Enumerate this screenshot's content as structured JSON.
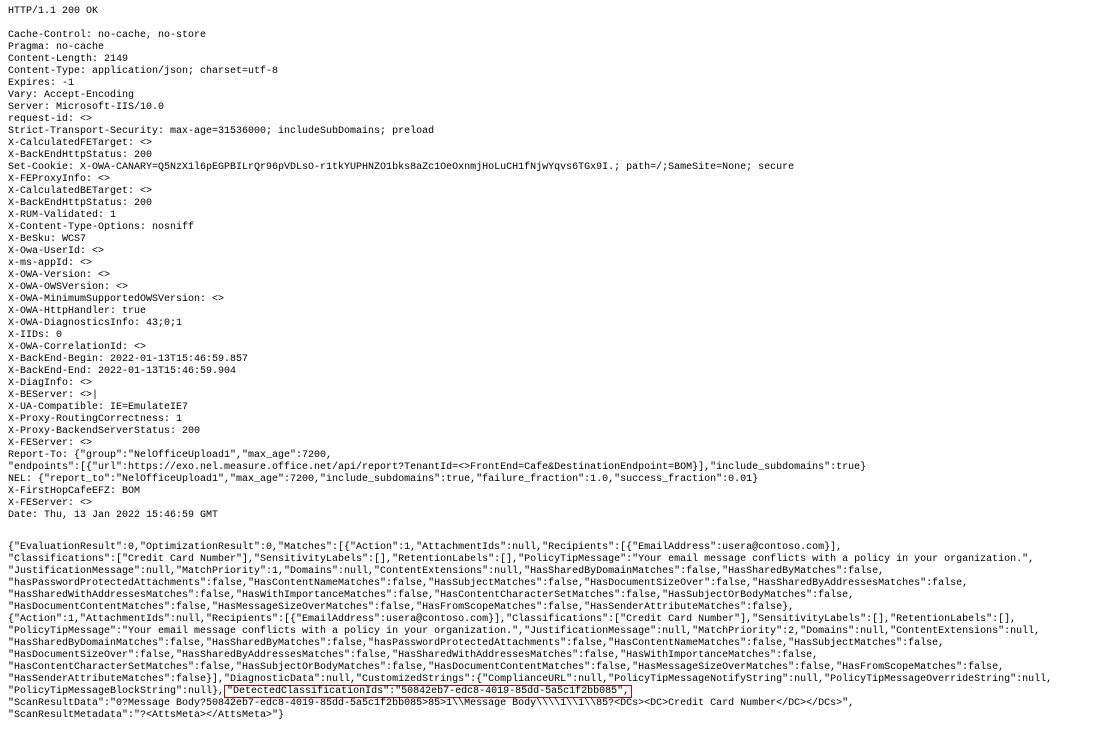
{
  "http": {
    "status_line": "HTTP/1.1 200 OK",
    "headers": [
      "Cache-Control: no-cache, no-store",
      "Pragma: no-cache",
      "Content-Length: 2149",
      "Content-Type: application/json; charset=utf-8",
      "Expires: -1",
      "Vary: Accept-Encoding",
      "Server: Microsoft-IIS/10.0",
      "request-id: <>",
      "Strict-Transport-Security: max-age=31536000; includeSubDomains; preload",
      "X-CalculatedFETarget: <>",
      "X-BackEndHttpStatus: 200",
      "Set-Cookie: X-OWA-CANARY=Q5NzX1l6pEGPBILrQr96pVDLsO-r1tkYUPHNZO1bks8aZc1OeOxnmjHoLuCH1fNjwYqvs6TGx9I.; path=/;SameSite=None; secure",
      "X-FEProxyInfo: <>",
      "X-CalculatedBETarget: <>",
      "X-BackEndHttpStatus: 200",
      "X-RUM-Validated: 1",
      "X-Content-Type-Options: nosniff",
      "X-BeSku: WCS7",
      "X-Owa-UserId: <>",
      "x-ms-appId: <>",
      "X-OWA-Version: <>",
      "X-OWA-OWSVersion: <>",
      "X-OWA-MinimumSupportedOWSVersion: <>",
      "X-OWA-HttpHandler: true",
      "X-OWA-DiagnosticsInfo: 43;0;1",
      "X-IIDs: 0",
      "X-OWA-CorrelationId: <>",
      "X-BackEnd-Begin: 2022-01-13T15:46:59.857",
      "X-BackEnd-End: 2022-01-13T15:46:59.904",
      "X-DiagInfo: <>",
      "X-BEServer: <>|",
      "X-UA-Compatible: IE=EmulateIE7",
      "X-Proxy-RoutingCorrectness: 1",
      "X-Proxy-BackendServerStatus: 200",
      "X-FEServer: <>",
      "Report-To: {\"group\":\"NelOfficeUpload1\",\"max_age\":7200,",
      "\"endpoints\":[{\"url\":https://exo.nel.measure.office.net/api/report?TenantId=<>FrontEnd=Cafe&DestinationEndpoint=BOM}],\"include_subdomains\":true}",
      "NEL: {\"report_to\":\"NelOfficeUpload1\",\"max_age\":7200,\"include_subdomains\":true,\"failure_fraction\":1.0,\"success_fraction\":0.01}",
      "X-FirstHopCafeEFZ: BOM",
      "X-FEServer: <>",
      "Date: Thu, 13 Jan 2022 15:46:59 GMT"
    ]
  },
  "body": {
    "part1": "{\"EvaluationResult\":0,\"OptimizationResult\":0,\"Matches\":[{\"Action\":1,\"AttachmentIds\":null,\"Recipients\":[{\"EmailAddress\":usera@contoso.com}],\n\"Classifications\":[\"Credit Card Number\"],\"SensitivityLabels\":[],\"RetentionLabels\":[],\"PolicyTipMessage\":\"Your email message conflicts with a policy in your organization.\",\n\"JustificationMessage\":null,\"MatchPriority\":1,\"Domains\":null,\"ContentExtensions\":null,\"HasSharedByDomainMatches\":false,\"HasSharedByMatches\":false,\n\"hasPasswordProtectedAttachments\":false,\"HasContentNameMatches\":false,\"HasSubjectMatches\":false,\"HasDocumentSizeOver\":false,\"HasSharedByAddressesMatches\":false,\n\"HasSharedWithAddressesMatches\":false,\"HasWithImportanceMatches\":false,\"HasContentCharacterSetMatches\":false,\"HasSubjectOrBodyMatches\":false,\n\"HasDocumentContentMatches\":false,\"HasMessageSizeOverMatches\":false,\"HasFromScopeMatches\":false,\"HasSenderAttributeMatches\":false},\n{\"Action\":1,\"AttachmentIds\":null,\"Recipients\":[{\"EmailAddress\":usera@contoso.com}],\"Classifications\":[\"Credit Card Number\"],\"SensitivityLabels\":[],\"RetentionLabels\":[],\n\"PolicyTipMessage\":\"Your email message conflicts with a policy in your organization.\",\"JustificationMessage\":null,\"MatchPriority\":2,\"Domains\":null,\"ContentExtensions\":null,\n\"HasSharedByDomainMatches\":false,\"HasSharedByMatches\":false,\"hasPasswordProtectedAttachments\":false,\"HasContentNameMatches\":false,\"HasSubjectMatches\":false,\n\"HasDocumentSizeOver\":false,\"HasSharedByAddressesMatches\":false,\"HasSharedWithAddressesMatches\":false,\"HasWithImportanceMatches\":false,\n\"HasContentCharacterSetMatches\":false,\"HasSubjectOrBodyMatches\":false,\"HasDocumentContentMatches\":false,\"HasMessageSizeOverMatches\":false,\"HasFromScopeMatches\":false,\n\"HasSenderAttributeMatches\":false}],\"DiagnosticData\":null,\"CustomizedStrings\":{\"ComplianceURL\":null,\"PolicyTipMessageNotifyString\":null,\"PolicyTipMessageOverrideString\":null,\n\"PolicyTipMessageBlockString\":null},",
    "highlight": "\"DetectedClassificationIds\":\"50842eb7-edc8-4019-85dd-5a5c1f2bb085\",",
    "part2": "\n\"ScanResultData\":\"0?Message Body?50842eb7-edc8-4019-85dd-5a5c1f2bb085>85>1\\\\Message Body\\\\\\\\1\\\\1\\\\85?<DCs><DC>Credit Card Number</DC></DCs>\",\n\"ScanResultMetadata\":\"?<AttsMeta></AttsMeta>\"}"
  }
}
